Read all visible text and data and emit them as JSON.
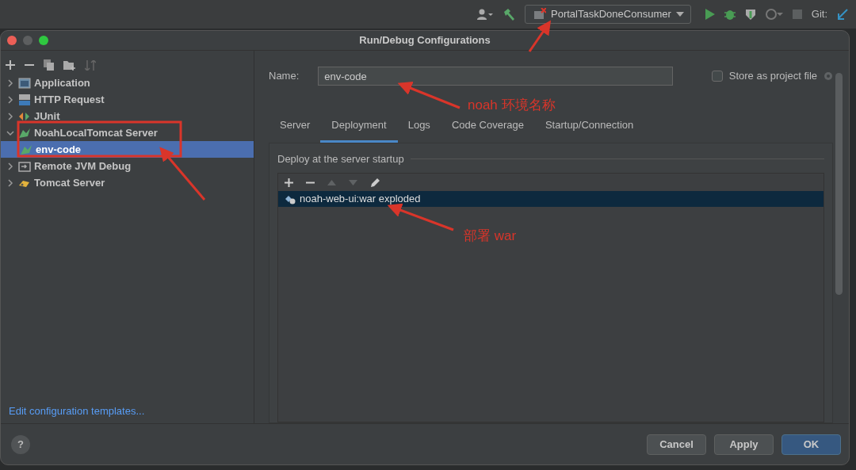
{
  "toolbar": {
    "run_config": "PortalTaskDoneConsumer",
    "vcs_label": "Git:"
  },
  "window": {
    "title": "Run/Debug Configurations"
  },
  "sidebar": {
    "items": [
      {
        "label": "Application",
        "kind": "application",
        "expanded": false,
        "selected": false
      },
      {
        "label": "HTTP Request",
        "kind": "http",
        "expanded": false,
        "selected": false
      },
      {
        "label": "JUnit",
        "kind": "junit",
        "expanded": false,
        "selected": false
      },
      {
        "label": "NoahLocalTomcat Server",
        "kind": "tomcat",
        "expanded": true,
        "selected": false,
        "children": [
          {
            "label": "env-code",
            "kind": "tomcat",
            "selected": true
          }
        ]
      },
      {
        "label": "Remote JVM Debug",
        "kind": "remote",
        "expanded": false,
        "selected": false
      },
      {
        "label": "Tomcat Server",
        "kind": "cat",
        "expanded": false,
        "selected": false
      }
    ],
    "footer_link": "Edit configuration templates..."
  },
  "name_field": {
    "label": "Name:",
    "value": "env-code"
  },
  "store_checkbox": {
    "label": "Store as project file",
    "checked": false
  },
  "tabs": [
    {
      "label": "Server",
      "selected": false
    },
    {
      "label": "Deployment",
      "selected": true
    },
    {
      "label": "Logs",
      "selected": false
    },
    {
      "label": "Code Coverage",
      "selected": false
    },
    {
      "label": "Startup/Connection",
      "selected": false
    }
  ],
  "deployment": {
    "title": "Deploy at the server startup",
    "items": [
      {
        "label": "noah-web-ui:war exploded",
        "selected": true
      }
    ]
  },
  "help_button": "?",
  "buttons": [
    {
      "label": "Cancel",
      "kind": "secondary"
    },
    {
      "label": "Apply",
      "kind": "secondary"
    },
    {
      "label": "OK",
      "kind": "primary"
    }
  ],
  "annotations": [
    {
      "text": "noah 环境名称"
    },
    {
      "text": "部署 war"
    }
  ]
}
